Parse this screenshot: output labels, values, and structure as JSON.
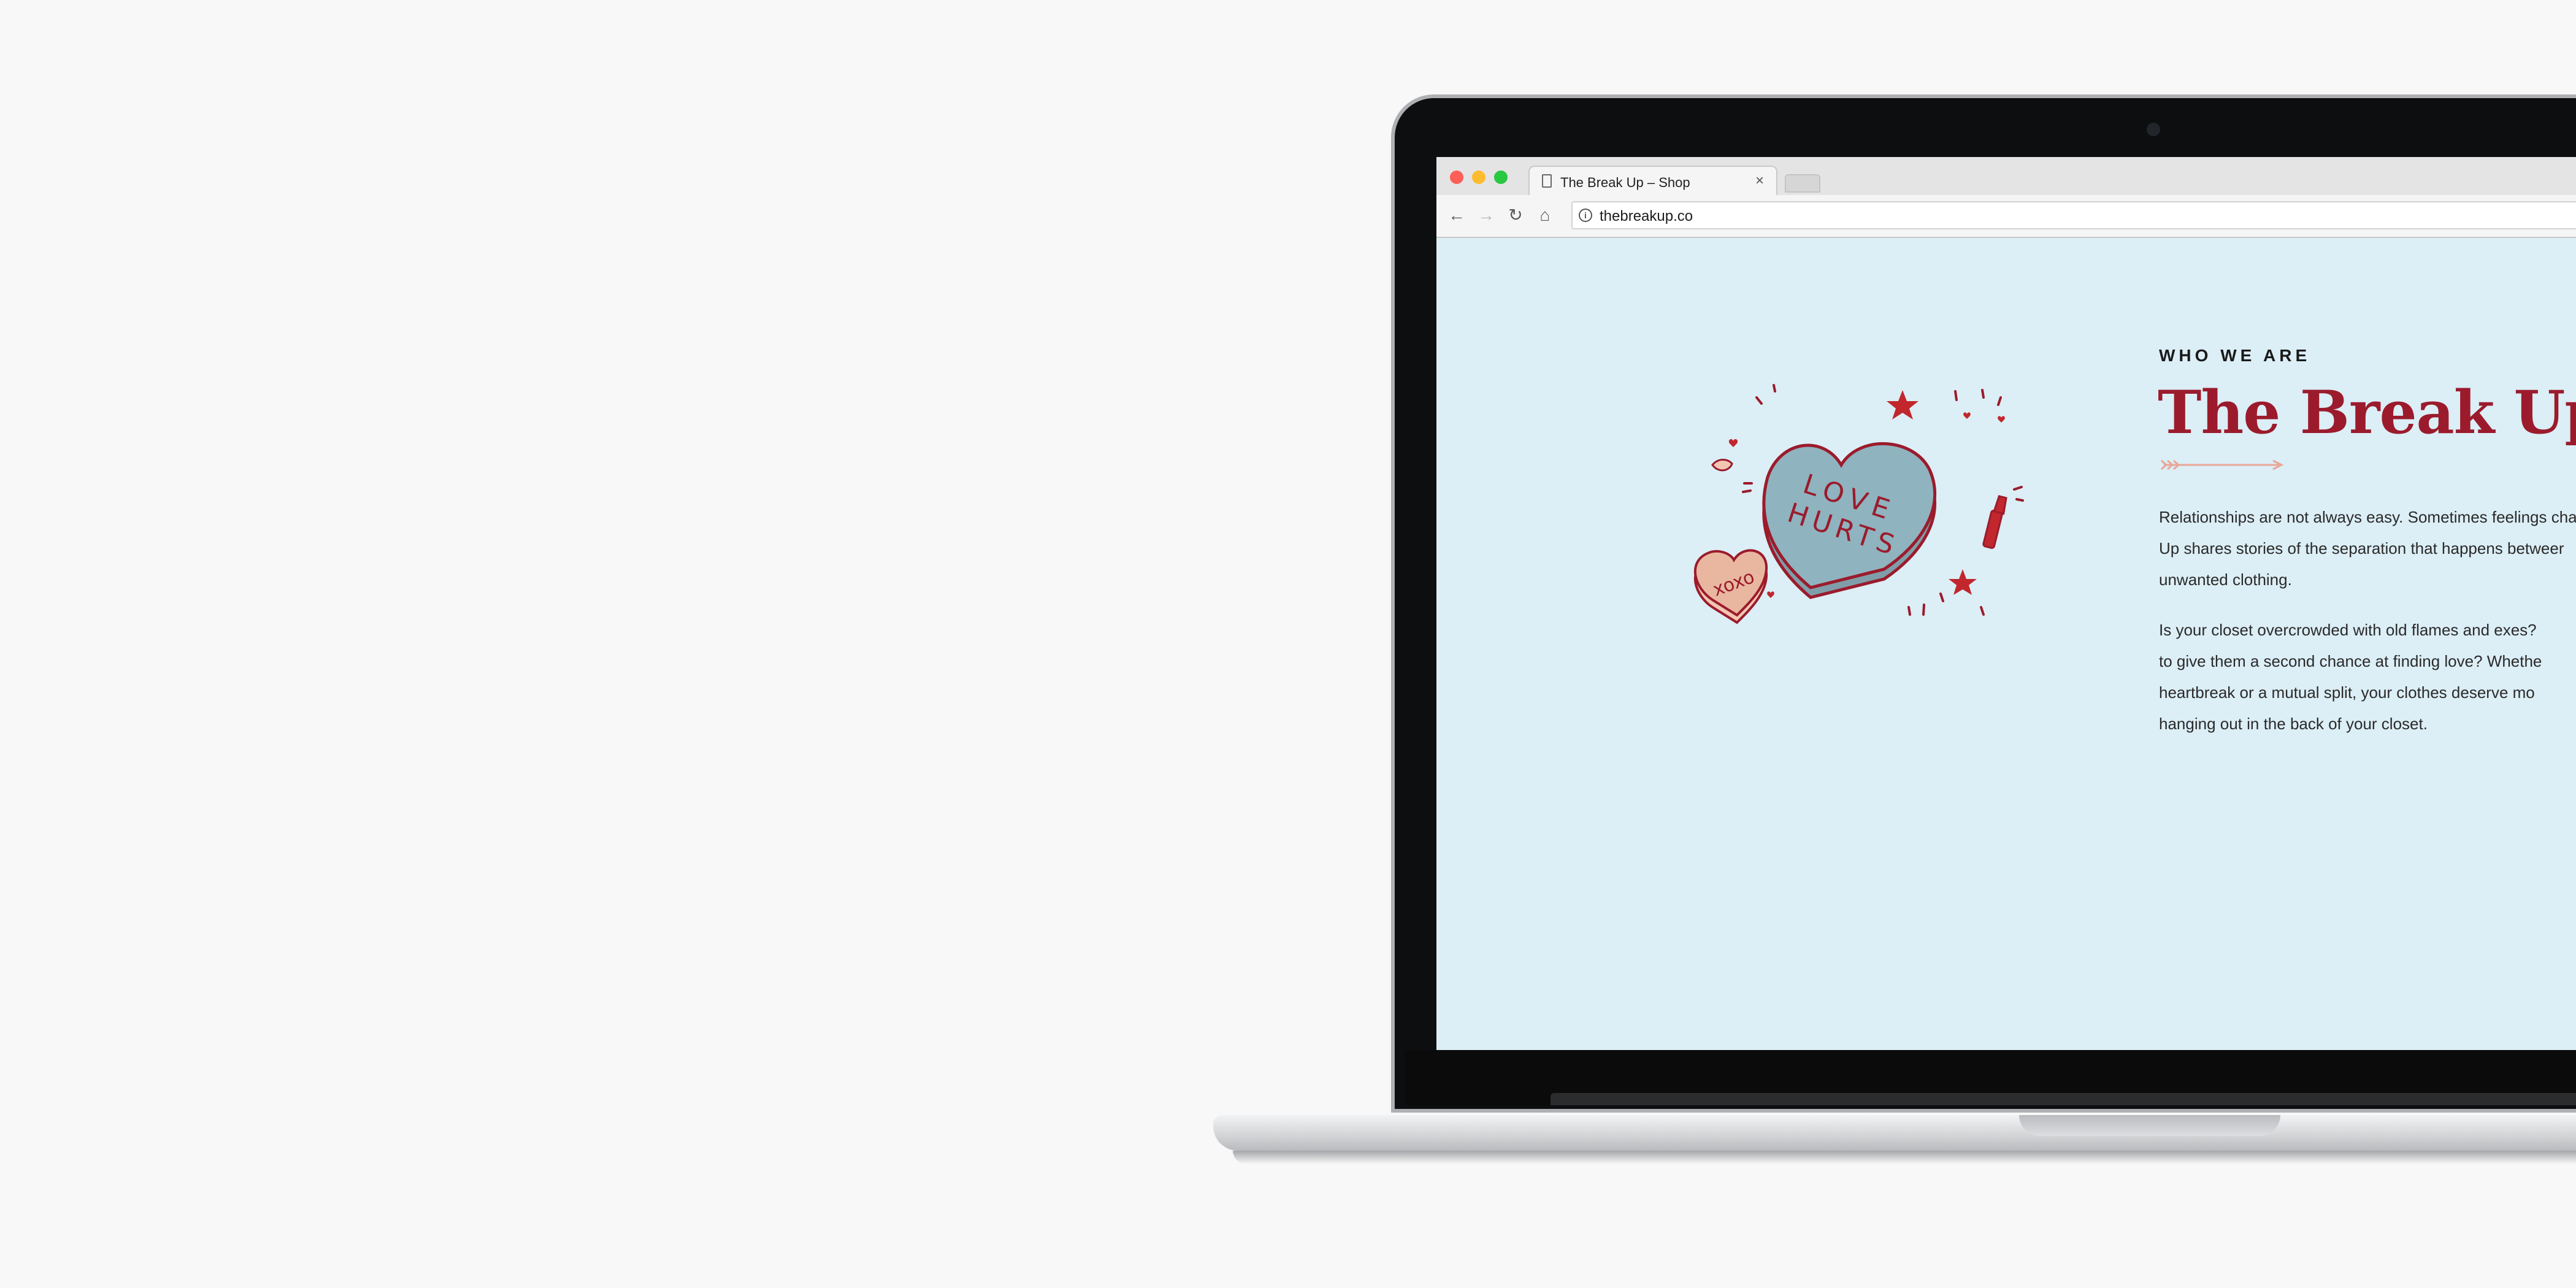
{
  "browser": {
    "tab_title": "The Break Up – Shop",
    "tab_close": "×",
    "url": "thebreakup.co",
    "icons": {
      "back": "back-arrow-icon",
      "forward": "forward-arrow-icon",
      "reload": "reload-icon",
      "home": "home-icon",
      "info": "info-icon"
    },
    "glyphs": {
      "back": "←",
      "forward": "→",
      "reload": "↻",
      "home": "⌂",
      "info": "i"
    }
  },
  "hero": {
    "eyebrow": "WHO WE ARE",
    "title": "The Break Up",
    "paragraph_1": [
      "Relationships are not always easy. Sometimes feelings cha",
      "Up shares stories of the separation that happens betweer",
      "unwanted clothing."
    ],
    "paragraph_2": [
      "Is your closet overcrowded with old flames and exes?",
      "to give them a second chance at finding love? Whethe",
      "heartbreak or a mutual split, your clothes deserve mo",
      "hanging out in the back of your closet."
    ],
    "illustration": {
      "big_heart_text": [
        "LOVE",
        "HURTS"
      ],
      "small_heart_text": "xoxo"
    }
  },
  "colors": {
    "page_background": "#dceef6",
    "accent_red": "#9b1b2c",
    "heart_blue": "#8fb3bf",
    "heart_peach": "#e9b7a0"
  }
}
